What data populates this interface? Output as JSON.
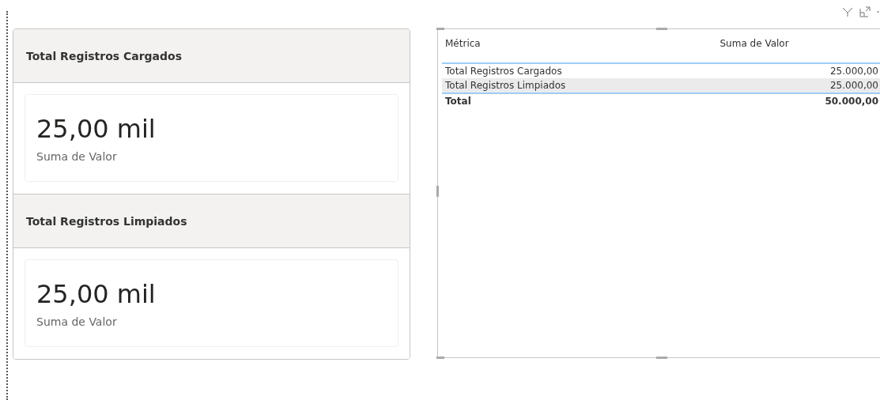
{
  "cards": [
    {
      "title": "Total Registros Cargados",
      "value": "25,00 mil",
      "caption": "Suma de Valor"
    },
    {
      "title": "Total Registros Limpiados",
      "value": "25,00 mil",
      "caption": "Suma de Valor"
    }
  ],
  "table": {
    "columns": [
      "Métrica",
      "Suma de Valor"
    ],
    "rows": [
      [
        "Total Registros Cargados",
        "25.000,00"
      ],
      [
        "Total Registros Limpiados",
        "25.000,00"
      ]
    ],
    "total": [
      "Total",
      "50.000,00"
    ]
  }
}
